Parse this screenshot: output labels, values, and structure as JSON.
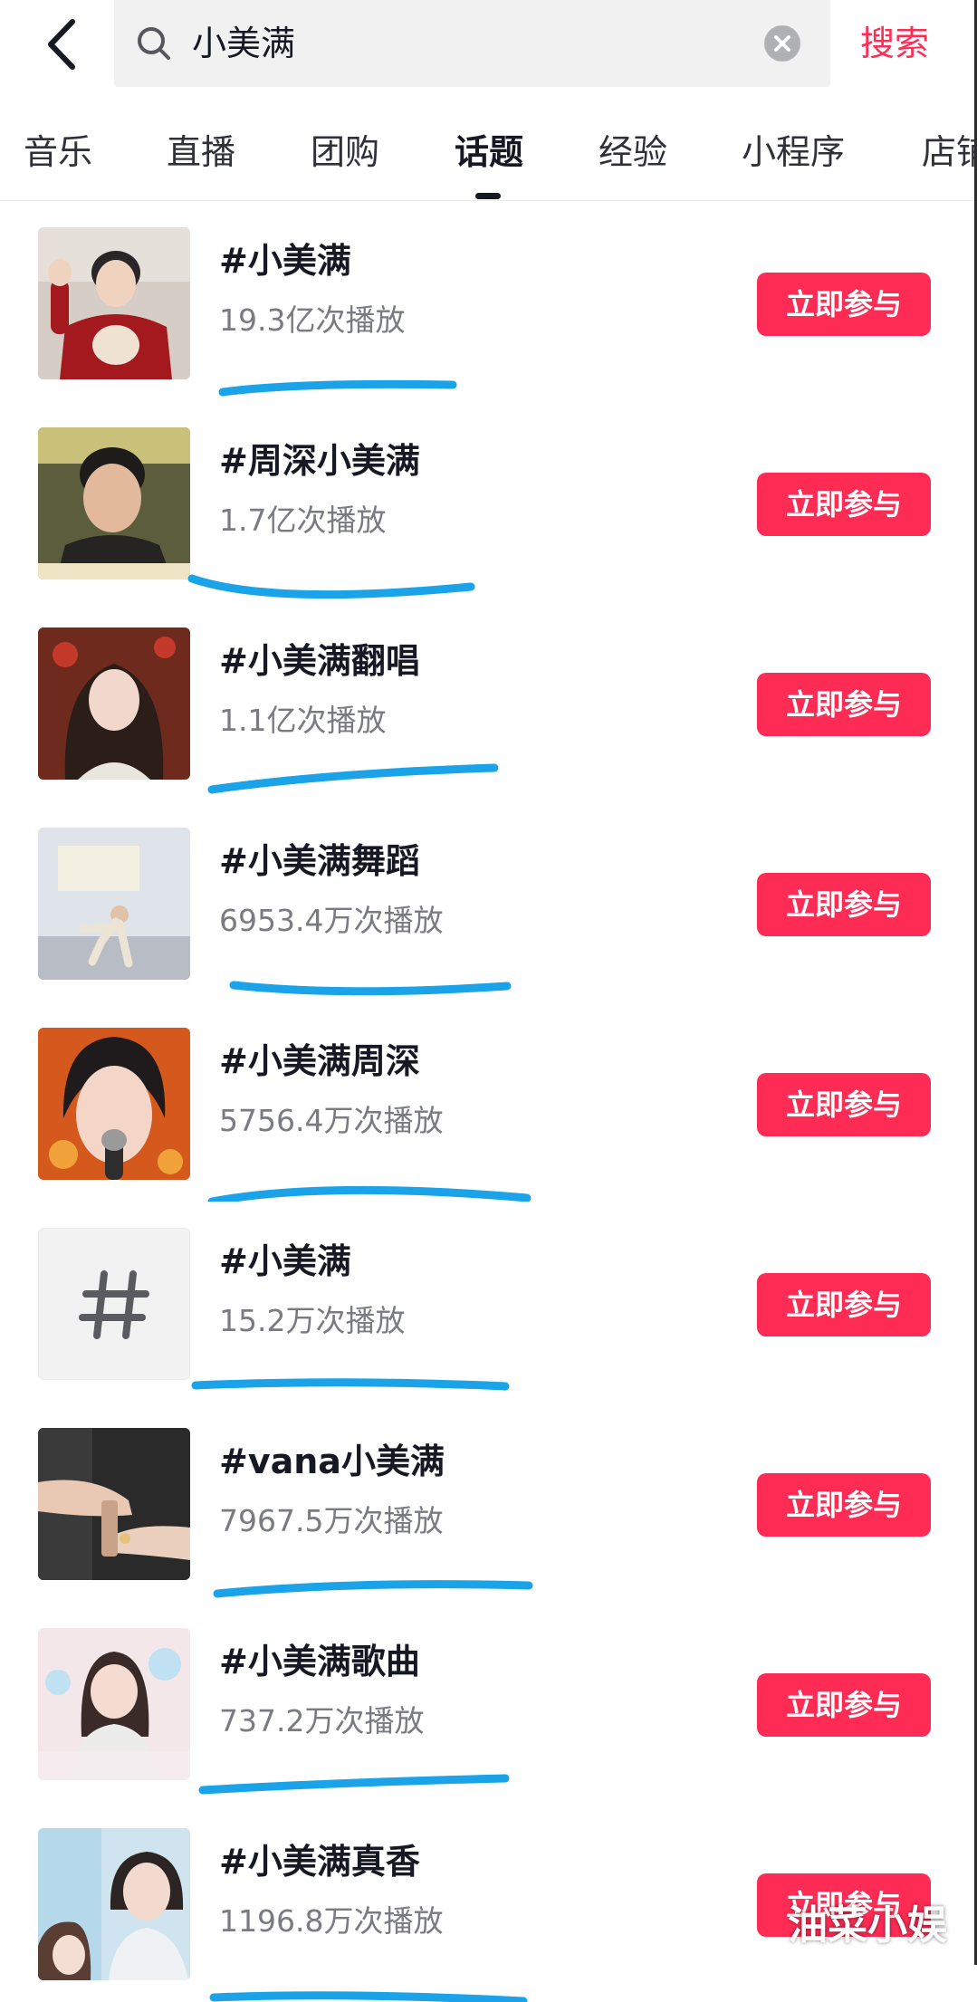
{
  "search": {
    "query": "小美满",
    "submit_label": "搜索"
  },
  "tabs": [
    {
      "label": "音乐"
    },
    {
      "label": "直播"
    },
    {
      "label": "团购"
    },
    {
      "label": "话题",
      "active": true
    },
    {
      "label": "经验"
    },
    {
      "label": "小程序"
    },
    {
      "label": "店铺"
    }
  ],
  "join_label": "立即参与",
  "topics": [
    {
      "title": "#小美满",
      "views": "19.3亿次播放",
      "thumb": "person-red-sweater-icon"
    },
    {
      "title": "#周深小美满",
      "views": "1.7亿次播放",
      "thumb": "person-portrait-icon"
    },
    {
      "title": "#小美满翻唱",
      "views": "1.1亿次播放",
      "thumb": "girl-long-hair-icon"
    },
    {
      "title": "#小美满舞蹈",
      "views": "6953.4万次播放",
      "thumb": "dancer-icon"
    },
    {
      "title": "#小美满周深",
      "views": "5756.4万次播放",
      "thumb": "singer-microphone-icon"
    },
    {
      "title": "#小美满",
      "views": "15.2万次播放",
      "thumb": "hashtag-icon"
    },
    {
      "title": "#vana小美满",
      "views": "7967.5万次播放",
      "thumb": "hands-icon"
    },
    {
      "title": "#小美满歌曲",
      "views": "737.2万次播放",
      "thumb": "girl-flowers-icon"
    },
    {
      "title": "#小美满真香",
      "views": "1196.8万次播放",
      "thumb": "couple-icon"
    }
  ],
  "watermark": "油菜小娱",
  "colors": {
    "accent": "#fe2c55",
    "underline": "#1aa3e8",
    "search_bg": "#f1f1f2"
  }
}
